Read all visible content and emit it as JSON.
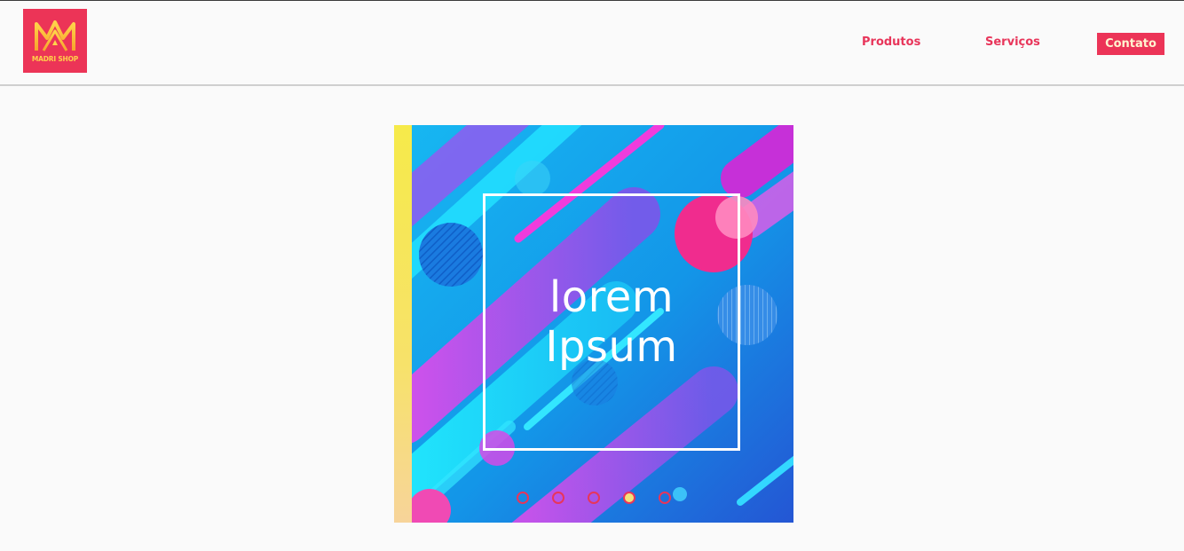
{
  "brand": {
    "name": "MADRI SHOP",
    "color": "#ec3457",
    "accent": "#ffcf4a"
  },
  "nav": {
    "items": [
      {
        "label": "Produtos"
      },
      {
        "label": "Serviços"
      },
      {
        "label": "Contato"
      }
    ]
  },
  "carousel": {
    "slide": {
      "line1": "lorem",
      "line2": "Ipsum"
    },
    "dot_count": 5,
    "active_index": 3
  }
}
